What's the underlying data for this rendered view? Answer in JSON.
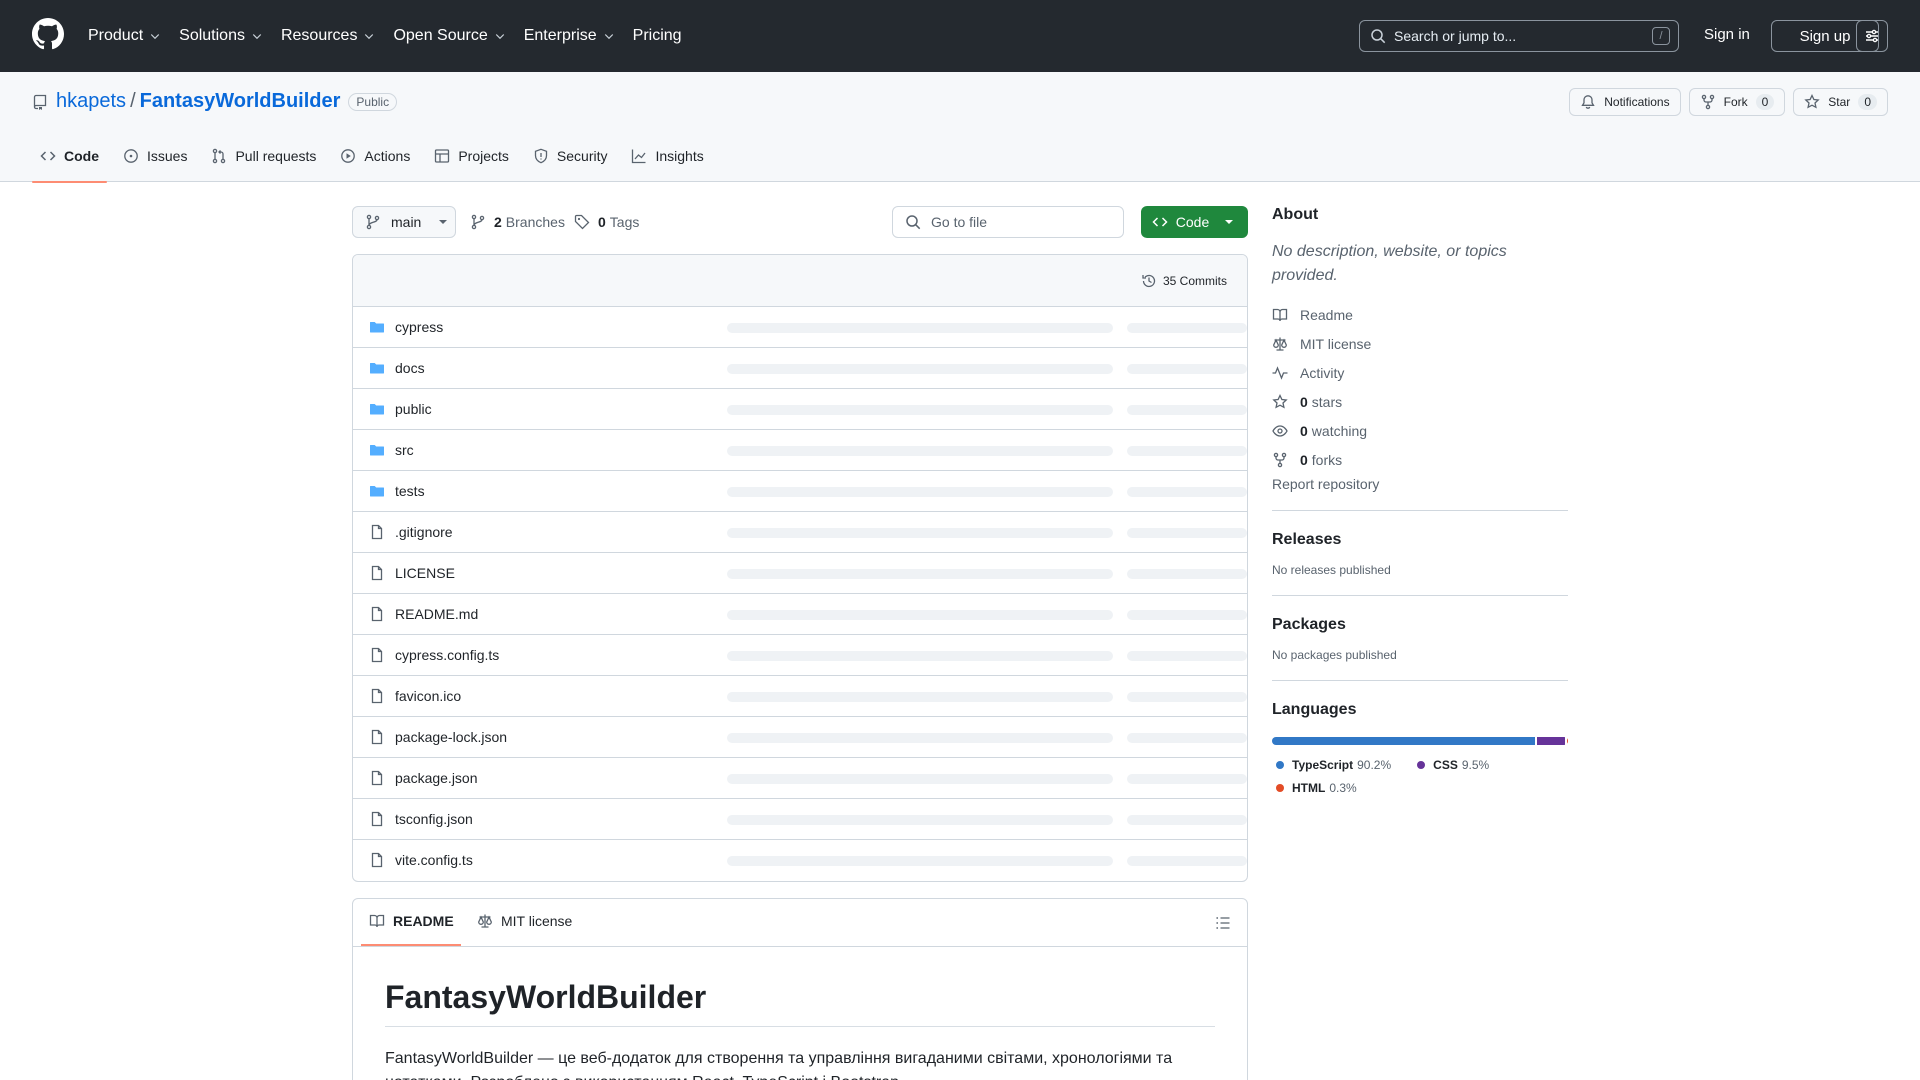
{
  "colors": {
    "header_bg": "#24292f",
    "link": "#0969da",
    "primary_button": "#1f883d",
    "active_tab_underline": "#fd8c73"
  },
  "header": {
    "nav": [
      {
        "label": "Product",
        "has_menu": true
      },
      {
        "label": "Solutions",
        "has_menu": true
      },
      {
        "label": "Resources",
        "has_menu": true
      },
      {
        "label": "Open Source",
        "has_menu": true
      },
      {
        "label": "Enterprise",
        "has_menu": true
      },
      {
        "label": "Pricing",
        "has_menu": false
      }
    ],
    "search_placeholder": "Search or jump to...",
    "search_shortcut": "/",
    "sign_in": "Sign in",
    "sign_up": "Sign up"
  },
  "repo": {
    "owner": "hkapets",
    "separator": "/",
    "name": "FantasyWorldBuilder",
    "visibility": "Public",
    "notifications_label": "Notifications",
    "fork_label": "Fork",
    "fork_count": "0",
    "star_label": "Star",
    "star_count": "0",
    "tabs": [
      {
        "label": "Code",
        "icon": "code-icon",
        "active": true
      },
      {
        "label": "Issues",
        "icon": "issue-opened-icon",
        "active": false
      },
      {
        "label": "Pull requests",
        "icon": "git-pull-request-icon",
        "active": false
      },
      {
        "label": "Actions",
        "icon": "play-icon",
        "active": false
      },
      {
        "label": "Projects",
        "icon": "table-icon",
        "active": false
      },
      {
        "label": "Security",
        "icon": "shield-icon",
        "active": false
      },
      {
        "label": "Insights",
        "icon": "graph-icon",
        "active": false
      }
    ]
  },
  "controls": {
    "branch": "main",
    "branches_count": "2",
    "branches_label": "Branches",
    "tags_count": "0",
    "tags_label": "Tags",
    "goto_file_placeholder": "Go to file",
    "code_button": "Code"
  },
  "files": {
    "commits_label": "35 Commits",
    "items": [
      {
        "name": "cypress",
        "type": "dir"
      },
      {
        "name": "docs",
        "type": "dir"
      },
      {
        "name": "public",
        "type": "dir"
      },
      {
        "name": "src",
        "type": "dir"
      },
      {
        "name": "tests",
        "type": "dir"
      },
      {
        "name": ".gitignore",
        "type": "file"
      },
      {
        "name": "LICENSE",
        "type": "file"
      },
      {
        "name": "README.md",
        "type": "file"
      },
      {
        "name": "cypress.config.ts",
        "type": "file"
      },
      {
        "name": "favicon.ico",
        "type": "file"
      },
      {
        "name": "package-lock.json",
        "type": "file"
      },
      {
        "name": "package.json",
        "type": "file"
      },
      {
        "name": "tsconfig.json",
        "type": "file"
      },
      {
        "name": "vite.config.ts",
        "type": "file"
      }
    ]
  },
  "readme": {
    "tab_readme": "README",
    "tab_license": "MIT license",
    "title": "FantasyWorldBuilder",
    "paragraph": "FantasyWorldBuilder — це веб-додаток для створення та управління вигаданими світами, хронологіями та нотатками. Розроблено з використанням React, TypeScript і Bootstrap."
  },
  "sidebar": {
    "about_title": "About",
    "about_desc": "No description, website, or topics provided.",
    "readme": "Readme",
    "license": "MIT license",
    "activity": "Activity",
    "stars_count": "0",
    "stars_label": "stars",
    "watching_count": "0",
    "watching_label": "watching",
    "forks_count": "0",
    "forks_label": "forks",
    "report": "Report repository",
    "releases_title": "Releases",
    "releases_empty": "No releases published",
    "packages_title": "Packages",
    "packages_empty": "No packages published",
    "languages_title": "Languages",
    "languages": [
      {
        "name": "TypeScript",
        "percent_label": "90.2%",
        "percent": 90.2,
        "color": "#3178c6"
      },
      {
        "name": "CSS",
        "percent_label": "9.5%",
        "percent": 9.5,
        "color": "#663399"
      },
      {
        "name": "HTML",
        "percent_label": "0.3%",
        "percent": 0.3,
        "color": "#e34c26"
      }
    ]
  }
}
